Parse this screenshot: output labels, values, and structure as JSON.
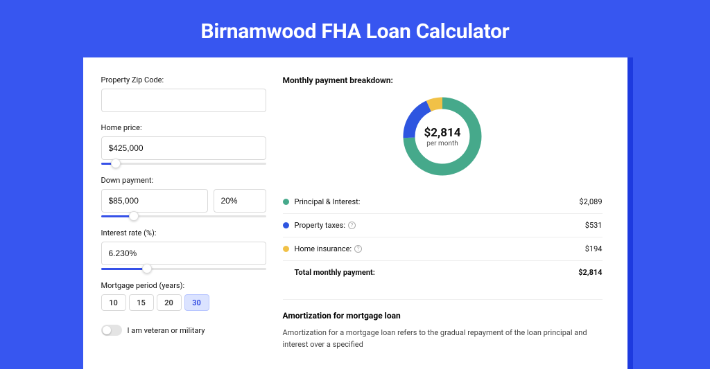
{
  "title": "Birnamwood FHA Loan Calculator",
  "form": {
    "zip_label": "Property Zip Code:",
    "zip_value": "",
    "price_label": "Home price:",
    "price_value": "$425,000",
    "price_pct": 9,
    "down_label": "Down payment:",
    "down_value": "$85,000",
    "down_pct_value": "20%",
    "down_slider_pct": 20,
    "rate_label": "Interest rate (%):",
    "rate_value": "6.230%",
    "rate_slider_pct": 28,
    "period_label": "Mortgage period (years):",
    "periods": [
      "10",
      "15",
      "20",
      "30"
    ],
    "period_selected": "30",
    "vet_label": "I am veteran or military"
  },
  "breakdown": {
    "title": "Monthly payment breakdown:",
    "amount": "$2,814",
    "sub": "per month",
    "items": [
      {
        "label": "Principal & Interest:",
        "value": "$2,089",
        "color": "#46a98b",
        "num": 2089,
        "info": false
      },
      {
        "label": "Property taxes:",
        "value": "$531",
        "color": "#2e55e0",
        "num": 531,
        "info": true
      },
      {
        "label": "Home insurance:",
        "value": "$194",
        "color": "#f1c147",
        "num": 194,
        "info": true
      }
    ],
    "total_label": "Total monthly payment:",
    "total_value": "$2,814"
  },
  "amort": {
    "title": "Amortization for mortgage loan",
    "text": "Amortization for a mortgage loan refers to the gradual repayment of the loan principal and interest over a specified"
  },
  "chart_data": {
    "type": "pie",
    "title": "Monthly payment breakdown",
    "categories": [
      "Principal & Interest",
      "Property taxes",
      "Home insurance"
    ],
    "values": [
      2089,
      531,
      194
    ],
    "colors": [
      "#46a98b",
      "#2e55e0",
      "#f1c147"
    ],
    "total": 2814,
    "center_label": "$2,814 per month"
  }
}
